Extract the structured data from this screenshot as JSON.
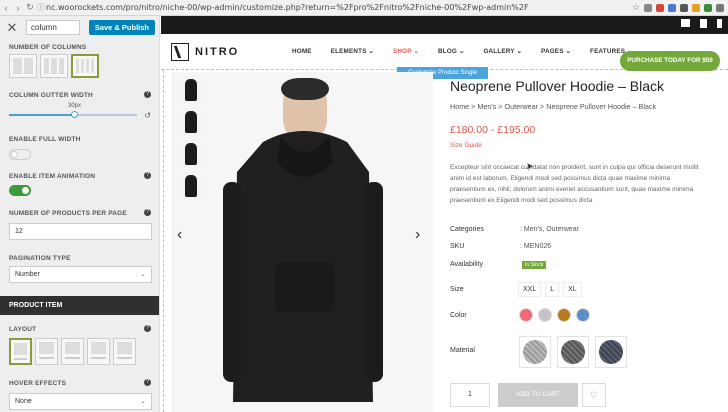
{
  "browser": {
    "url": "nc.woorockets.com/pro/nitro/niche-00/wp-admin/customize.php?return=%2Fpro%2Fnitro%2Fniche-00%2Fwp-admin%2F"
  },
  "panel": {
    "search_value": "column",
    "save_label": "Save & Publish",
    "number_of_columns": "NUMBER OF COLUMNS",
    "column_gutter": "COLUMN GUTTER WIDTH",
    "gutter_value": "30px",
    "enable_full_width": "ENABLE FULL WIDTH",
    "enable_item_animation": "ENABLE ITEM ANIMATION",
    "products_per_page_label": "NUMBER OF PRODUCTS PER PAGE",
    "products_per_page_value": "12",
    "pagination_type_label": "PAGINATION TYPE",
    "pagination_type_value": "Number",
    "product_item": "PRODUCT ITEM",
    "layout": "LAYOUT",
    "hover_effects": "HOVER EFFECTS",
    "hover_value": "None",
    "full_width_enabled": false,
    "item_animation_enabled": true,
    "gutter_fraction": 0.5
  },
  "site": {
    "logo": "NITRO",
    "menu": [
      "HOME",
      "ELEMENTS",
      "SHOP",
      "BLOG",
      "GALLERY",
      "PAGES",
      "FEATURES"
    ],
    "purchase": "PURCHASE TODAY FOR $59",
    "customize_tag": "Customize Product Single"
  },
  "product": {
    "title": "Neoprene Pullover Hoodie – Black",
    "breadcrumb": "Home  >  Men's  >  Outerwear  >  Neoprene Pullover Hoodie – Black",
    "price": "£180.00 - £195.00",
    "size_guide": "Size Guide",
    "description": "Excepteur sint occaecat cupidatat non proident, sunt in culpa qui officia deserunt mollit anim id est laborum. Eligendi modi sed possimus dicta quae maxime minima praesentium ex, nihil, dolorum animi everiet accusantium sunt, quae maxime minima praesentium ex Eligendi modi sed possimus dicta",
    "categories_label": "Categories",
    "categories": ": Men's, Outerwear",
    "sku_label": "SKU",
    "sku": ": MEN026",
    "availability_label": "Availability",
    "availability": "In Stock",
    "size_label": "Size",
    "sizes": [
      "XXL",
      "L",
      "XL"
    ],
    "color_label": "Color",
    "colors": [
      "#f06a75",
      "#c8c2c8",
      "#b57b1d",
      "#5c8fc9"
    ],
    "material_label": "Material",
    "qty": "1",
    "add_to_cart": "ADD TO CART"
  }
}
